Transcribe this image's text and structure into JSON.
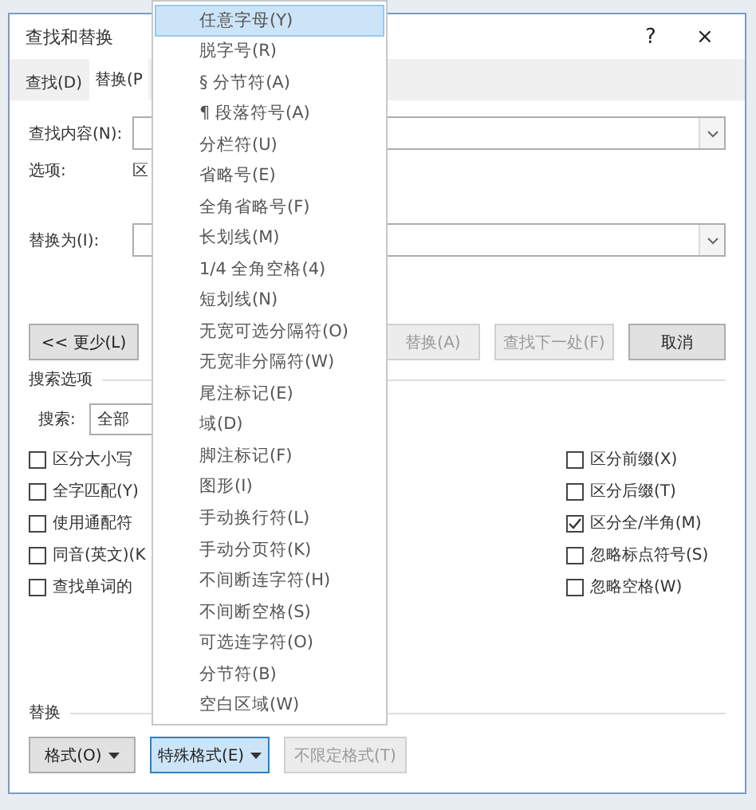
{
  "window": {
    "title": "查找和替换",
    "help": "?",
    "close": "×"
  },
  "tabs": [
    {
      "label": "查找(D)",
      "selected": false
    },
    {
      "label": "替换(P",
      "selected": true
    }
  ],
  "find": {
    "label": "查找内容(N):"
  },
  "options": {
    "label": "选项:",
    "value": "区"
  },
  "replace": {
    "label": "替换为(I):"
  },
  "less_button": {
    "label": "<< 更少(L)",
    "disabled": false
  },
  "buttons": [
    {
      "label": "替换(A)",
      "disabled": true
    },
    {
      "label": "查找下一处(F)",
      "disabled": true
    },
    {
      "label": "取消",
      "disabled": false
    }
  ],
  "search_options": {
    "title": "搜索选项",
    "search_label": "搜索:",
    "search_value": "全部",
    "left": [
      {
        "label": "区分大小写",
        "checked": false
      },
      {
        "label": "全字匹配(Y)",
        "checked": false
      },
      {
        "label": "使用通配符",
        "checked": false
      },
      {
        "label": "同音(英文)(K",
        "checked": false
      },
      {
        "label": "查找单词的",
        "checked": false
      }
    ],
    "right": [
      {
        "label": "区分前缀(X)",
        "checked": false
      },
      {
        "label": "区分后缀(T)",
        "checked": false
      },
      {
        "label": "区分全/半角(M)",
        "checked": true
      },
      {
        "label": "忽略标点符号(S)",
        "checked": false
      },
      {
        "label": "忽略空格(W)",
        "checked": false
      }
    ]
  },
  "replace_section": {
    "title": "替换",
    "buttons": [
      {
        "label": "格式(O)",
        "dropdown": true,
        "pressed": false,
        "disabled": false
      },
      {
        "label": "特殊格式(E)",
        "dropdown": true,
        "pressed": true,
        "disabled": false
      },
      {
        "label": "不限定格式(T)",
        "dropdown": false,
        "pressed": false,
        "disabled": true
      }
    ]
  },
  "menu": {
    "items": [
      {
        "label": "任意字母(Y)",
        "selected": true
      },
      {
        "label": "脱字号(R)",
        "selected": false
      },
      {
        "label": "§ 分节符(A)",
        "selected": false
      },
      {
        "label": "¶ 段落符号(A)",
        "selected": false
      },
      {
        "label": "分栏符(U)",
        "selected": false
      },
      {
        "label": "省略号(E)",
        "selected": false
      },
      {
        "label": "全角省略号(F)",
        "selected": false
      },
      {
        "label": "长划线(M)",
        "selected": false
      },
      {
        "label": "1/4 全角空格(4)",
        "selected": false
      },
      {
        "label": "短划线(N)",
        "selected": false
      },
      {
        "label": "无宽可选分隔符(O)",
        "selected": false
      },
      {
        "label": "无宽非分隔符(W)",
        "selected": false
      },
      {
        "label": "尾注标记(E)",
        "selected": false
      },
      {
        "label": "域(D)",
        "selected": false
      },
      {
        "label": "脚注标记(F)",
        "selected": false
      },
      {
        "label": "图形(I)",
        "selected": false
      },
      {
        "label": "手动换行符(L)",
        "selected": false
      },
      {
        "label": "手动分页符(K)",
        "selected": false
      },
      {
        "label": "不间断连字符(H)",
        "selected": false
      },
      {
        "label": "不间断空格(S)",
        "selected": false
      },
      {
        "label": "可选连字符(O)",
        "selected": false
      },
      {
        "label": "分节符(B)",
        "selected": false
      },
      {
        "label": "空白区域(W)",
        "selected": false
      }
    ]
  }
}
